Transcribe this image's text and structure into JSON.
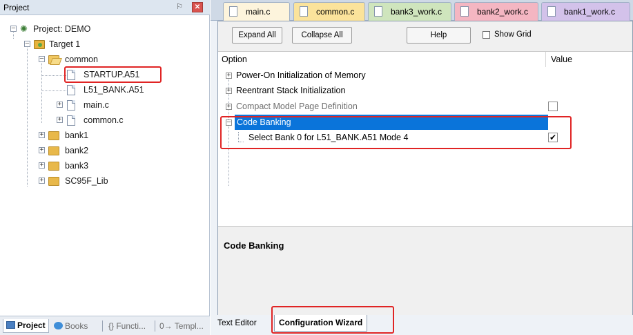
{
  "project_panel": {
    "title": "Project",
    "pin_glyph": "ᵖ",
    "close_glyph": "✕",
    "tree": {
      "project": "Project: DEMO",
      "target": "Target 1",
      "group_common": "common",
      "file_startup": "STARTUP.A51",
      "file_l51bank": "L51_BANK.A51",
      "file_main": "main.c",
      "file_common": "common.c",
      "group_bank1": "bank1",
      "group_bank2": "bank2",
      "group_bank3": "bank3",
      "group_lib": "SC95F_Lib"
    },
    "bottom_tabs": [
      "Project",
      "Books",
      "{} Functi...",
      "0→ Templ..."
    ]
  },
  "editor": {
    "tabs": [
      {
        "label": "main.c",
        "color": "#fdf4dc"
      },
      {
        "label": "common.c",
        "color": "#fbe39b"
      },
      {
        "label": "bank3_work.c",
        "color": "#cfe5bd"
      },
      {
        "label": "bank2_work.c",
        "color": "#f4b6c2"
      },
      {
        "label": "bank1_work.c",
        "color": "#d3c2ea"
      }
    ],
    "wizard": {
      "toolbar": {
        "expand_all": "Expand All",
        "collapse_all": "Collapse All",
        "help": "Help",
        "show_grid": "Show Grid"
      },
      "columns": {
        "option": "Option",
        "value": "Value"
      },
      "options": {
        "power_on": "Power-On Initialization of Memory",
        "reentrant": "Reentrant Stack Initialization",
        "compact": "Compact Model Page Definition",
        "code_banking": "Code Banking",
        "select_bank": "Select Bank 0 for L51_BANK.A51 Mode 4"
      },
      "select_bank_checked": "✔",
      "description_title": "Code Banking"
    },
    "bottom_tabs": {
      "text_editor": "Text Editor",
      "config_wizard": "Configuration Wizard"
    }
  },
  "colors": {
    "highlight": "#0a74da",
    "annotation_red": "#e02424"
  }
}
